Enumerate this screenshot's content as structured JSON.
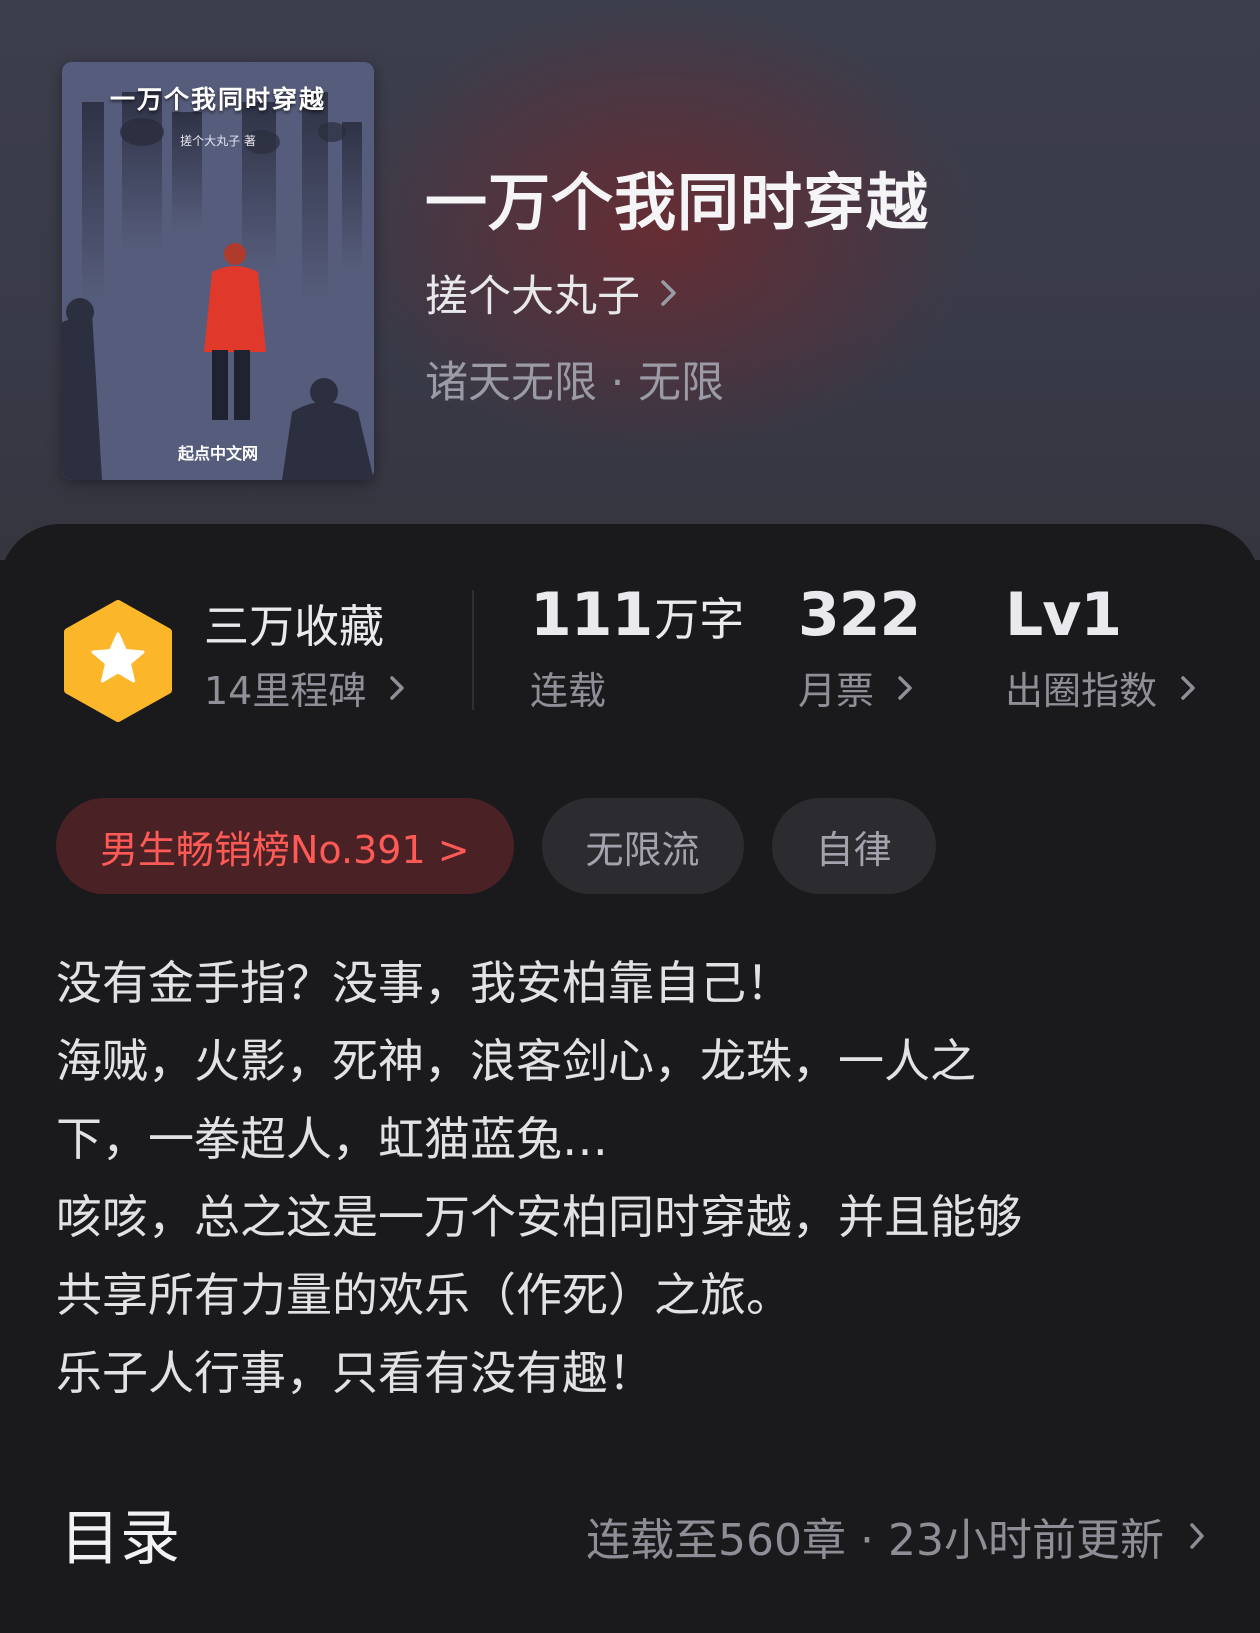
{
  "book": {
    "title": "一万个我同时穿越",
    "author": "搓个大丸子",
    "genre": "诸天无限 · 无限",
    "cover": {
      "title": "一万个我同时穿越",
      "author_line": "搓个大丸子 著",
      "publisher": "起点中文网"
    }
  },
  "stats": {
    "collection": {
      "main": "三万收藏",
      "sub": "14里程碑"
    },
    "words": {
      "number": "111",
      "unit": "万字",
      "sub": "连载"
    },
    "monthly_votes": {
      "number": "322",
      "sub": "月票"
    },
    "popularity": {
      "number": "Lv1",
      "sub": "出圈指数"
    }
  },
  "tags": [
    {
      "label": "男生畅销榜No.391 >"
    },
    {
      "label": "无限流"
    },
    {
      "label": "自律"
    }
  ],
  "description": [
    "没有金手指？没事，我安柏靠自己！",
    "海贼，火影，死神，浪客剑心，龙珠，一人之",
    "下，一拳超人，虹猫蓝兔…",
    "咳咳，总之这是一万个安柏同时穿越，并且能够",
    "共享所有力量的欢乐（作死）之旅。",
    "乐子人行事，只看有没有趣！"
  ],
  "toc": {
    "title": "目录",
    "info": "连载至560章 · 23小时前更新"
  },
  "colors": {
    "accent_red": "#ff5a55",
    "badge_orange": "#fbb62a",
    "background": "#1a1a1c"
  },
  "icons": {
    "chevron": "chevron-right-icon",
    "badge": "star-hexagon-icon"
  }
}
